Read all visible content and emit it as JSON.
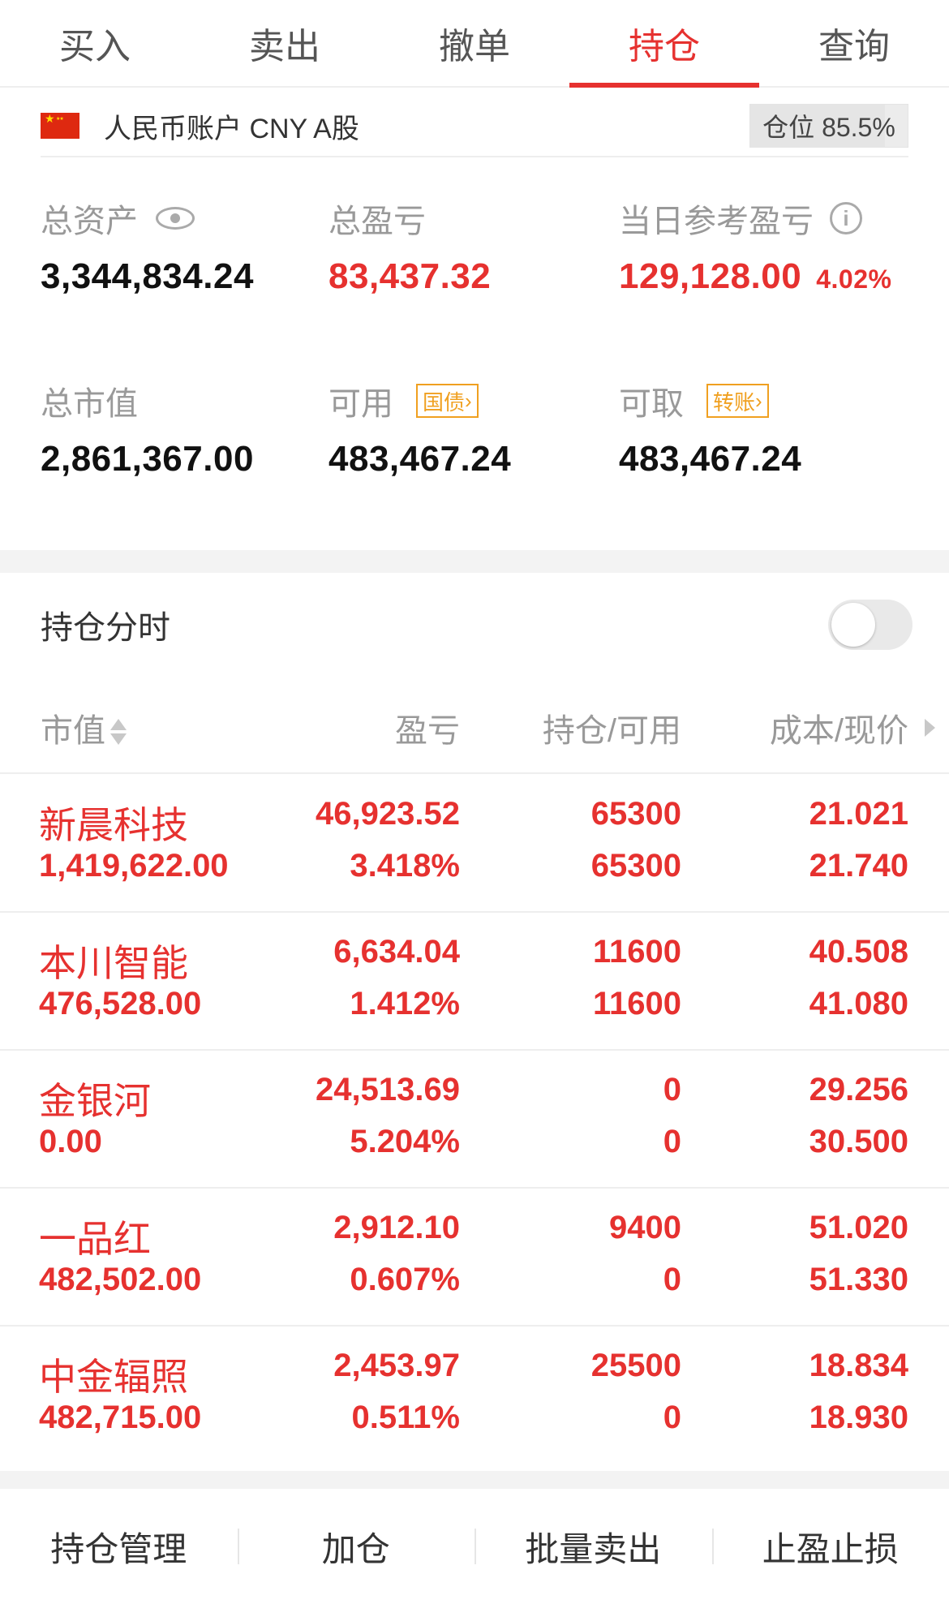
{
  "tabs": [
    {
      "label": "买入"
    },
    {
      "label": "卖出"
    },
    {
      "label": "撤单"
    },
    {
      "label": "持仓",
      "active": true
    },
    {
      "label": "查询"
    }
  ],
  "account": {
    "flag_icon": "china-flag-icon",
    "name": "人民币账户 CNY A股",
    "position_label": "仓位 85.5%",
    "position_ratio": 0.855
  },
  "summary": {
    "total_assets_label": "总资产",
    "total_assets": "3,344,834.24",
    "total_pnl_label": "总盈亏",
    "total_pnl": "83,437.32",
    "daily_pnl_label": "当日参考盈亏",
    "daily_pnl": "129,128.00",
    "daily_pnl_pct": "4.02%",
    "market_value_label": "总市值",
    "market_value": "2,861,367.00",
    "available_label": "可用",
    "available_tag": "国债",
    "available": "483,467.24",
    "withdrawable_label": "可取",
    "withdrawable_tag": "转账",
    "withdrawable": "483,467.24"
  },
  "timeshare": {
    "title": "持仓分时",
    "enabled": false
  },
  "table": {
    "headers": [
      "市值",
      "盈亏",
      "持仓/可用",
      "成本/现价"
    ],
    "rows": [
      {
        "name": "新晨科技",
        "market_value": "1,419,622.00",
        "pnl": "46,923.52",
        "pnl_pct": "3.418%",
        "holding": "65300",
        "available": "65300",
        "cost": "21.021",
        "price": "21.740"
      },
      {
        "name": "本川智能",
        "market_value": "476,528.00",
        "pnl": "6,634.04",
        "pnl_pct": "1.412%",
        "holding": "11600",
        "available": "11600",
        "cost": "40.508",
        "price": "41.080"
      },
      {
        "name": "金银河",
        "market_value": "0.00",
        "pnl": "24,513.69",
        "pnl_pct": "5.204%",
        "holding": "0",
        "available": "0",
        "cost": "29.256",
        "price": "30.500"
      },
      {
        "name": "一品红",
        "market_value": "482,502.00",
        "pnl": "2,912.10",
        "pnl_pct": "0.607%",
        "holding": "9400",
        "available": "0",
        "cost": "51.020",
        "price": "51.330"
      },
      {
        "name": "中金辐照",
        "market_value": "482,715.00",
        "pnl": "2,453.97",
        "pnl_pct": "0.511%",
        "holding": "25500",
        "available": "0",
        "cost": "18.834",
        "price": "18.930"
      }
    ]
  },
  "actions": [
    "持仓管理",
    "加仓",
    "批量卖出",
    "止盈止损"
  ],
  "colors": {
    "accent": "#e6312f",
    "tag": "#f0a020"
  }
}
